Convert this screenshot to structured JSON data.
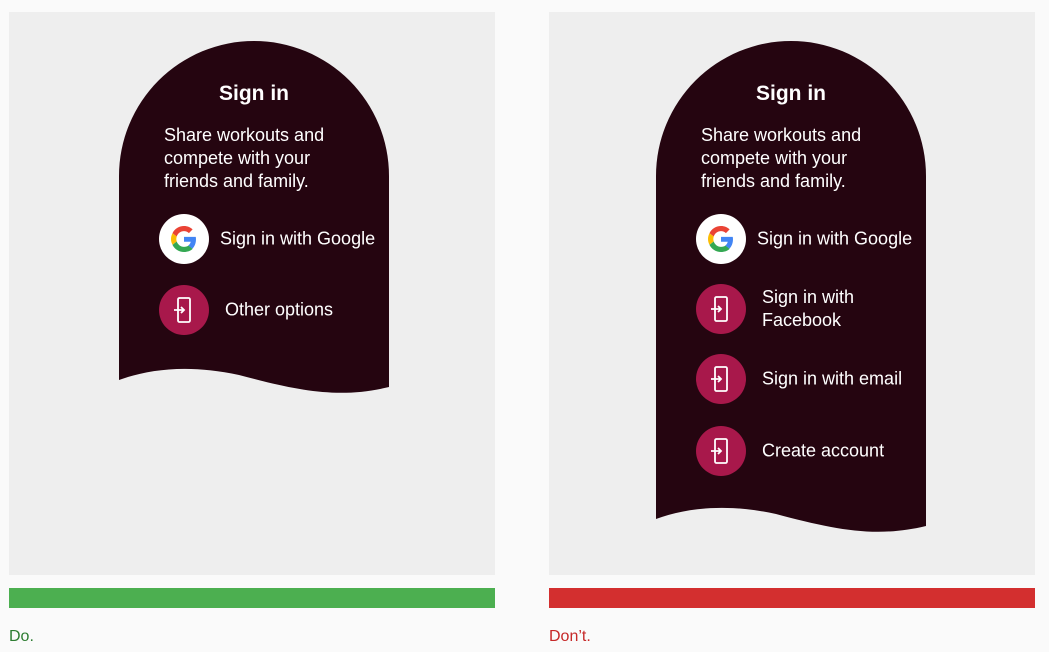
{
  "colors": {
    "panel_bg": "#eeeeee",
    "watch_bg": "#250510",
    "accent_maroon": "#a8184b",
    "do_green": "#4caf50",
    "dont_red": "#d32f2f"
  },
  "do_example": {
    "title": "Sign in",
    "subtitle": "Share workouts and compete with your friends and family.",
    "options": [
      {
        "icon": "google-icon",
        "label": "Sign in with Google"
      },
      {
        "icon": "phone-sign-in-icon",
        "label": "Other options"
      }
    ],
    "caption": "Do."
  },
  "dont_example": {
    "title": "Sign in",
    "subtitle": "Share workouts and compete with your friends and family.",
    "options": [
      {
        "icon": "google-icon",
        "label": "Sign in with Google"
      },
      {
        "icon": "phone-sign-in-icon",
        "label": "Sign in with Facebook"
      },
      {
        "icon": "phone-sign-in-icon",
        "label": "Sign in with email"
      },
      {
        "icon": "phone-sign-in-icon",
        "label": "Create account"
      }
    ],
    "caption": "Don’t."
  }
}
